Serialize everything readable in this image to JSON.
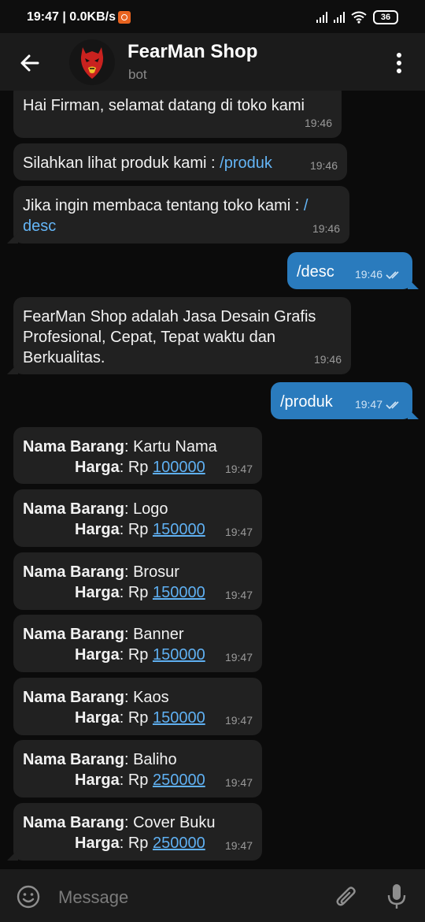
{
  "status_bar": {
    "time": "19:47",
    "network": "0.0KB/s",
    "battery": "36"
  },
  "header": {
    "title": "FearMan Shop",
    "subtitle": "bot"
  },
  "messages": [
    {
      "text": "Hai Firman, selamat datang di toko kami",
      "time": "19:46"
    },
    {
      "text": "Silahkan lihat produk kami : ",
      "command": "/produk",
      "time": "19:46"
    },
    {
      "text": "Jika ingin membaca tentang toko kami : ",
      "command_a": "/",
      "command_b": "desc",
      "time": "19:46"
    },
    {
      "text": "/desc",
      "time": "19:46"
    },
    {
      "line1": "FearMan Shop adalah Jasa Desain Grafis",
      "line2": "Profesional, Cepat, Tepat waktu dan",
      "line3": "Berkualitas.",
      "time": "19:46"
    },
    {
      "text": "/produk",
      "time": "19:47"
    }
  ],
  "product_labels": {
    "name": "Nama Barang",
    "price": "Harga",
    "currency": "Rp"
  },
  "products": [
    {
      "name": "Kartu Nama",
      "price": "100000",
      "time": "19:47"
    },
    {
      "name": "Logo",
      "price": "150000",
      "time": "19:47"
    },
    {
      "name": "Brosur",
      "price": "150000",
      "time": "19:47"
    },
    {
      "name": "Banner",
      "price": "150000",
      "time": "19:47"
    },
    {
      "name": "Kaos",
      "price": "150000",
      "time": "19:47"
    },
    {
      "name": "Baliho",
      "price": "250000",
      "time": "19:47"
    },
    {
      "name": "Cover Buku",
      "price": "250000",
      "time": "19:47"
    }
  ],
  "composer": {
    "placeholder": "Message"
  },
  "colors": {
    "incoming_bubble": "#212121",
    "outgoing_bubble": "#2a7bbd",
    "link": "#5fb0f2"
  }
}
